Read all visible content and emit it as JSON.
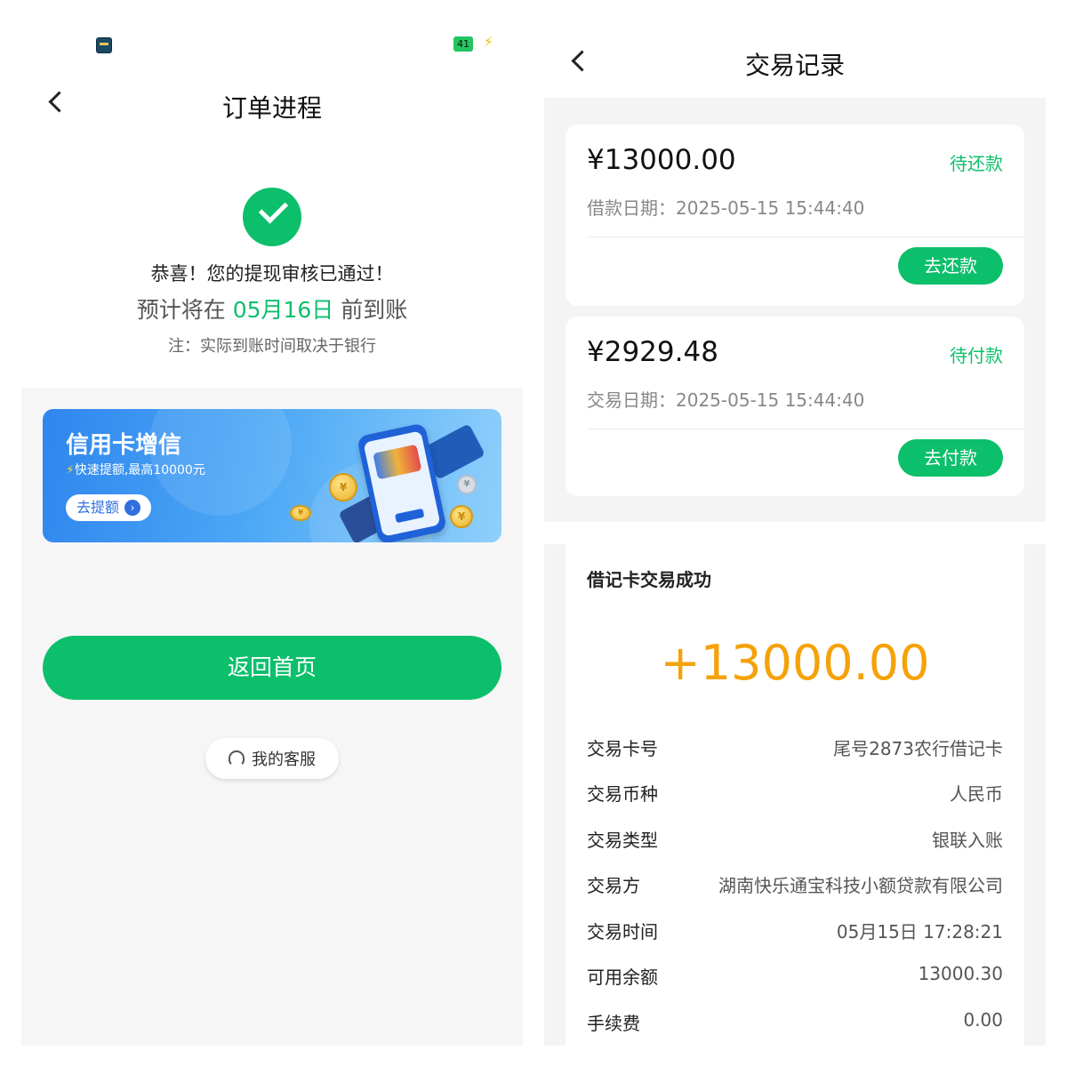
{
  "left": {
    "status": {
      "battery": "41"
    },
    "title": "订单进程",
    "message": "恭喜！您的提现审核已通过！",
    "eta_prefix": "预计将在",
    "eta_date": "05月16日",
    "eta_suffix": "前到账",
    "note": "注：实际到账时间取决于银行",
    "banner": {
      "title": "信用卡增信",
      "subtitle": "快速提额,最高10000元",
      "button": "去提额"
    },
    "home_button": "返回首页",
    "service_button": "我的客服"
  },
  "right": {
    "title": "交易记录",
    "records": [
      {
        "amount": "¥13000.00",
        "status": "待还款",
        "date": "借款日期：2025-05-15 15:44:40",
        "action": "去还款"
      },
      {
        "amount": "¥2929.48",
        "status": "待付款",
        "date": "交易日期：2025-05-15 15:44:40",
        "action": "去付款"
      }
    ],
    "detail": {
      "title": "借记卡交易成功",
      "amount": "+13000.00",
      "rows": [
        {
          "label": "交易卡号",
          "value": "尾号2873农行借记卡"
        },
        {
          "label": "交易币种",
          "value": "人民币"
        },
        {
          "label": "交易类型",
          "value": "银联入账"
        },
        {
          "label": "交易方",
          "value": "湖南快乐通宝科技小额贷款有限公司"
        },
        {
          "label": "交易时间",
          "value": "05月15日 17:28:21"
        },
        {
          "label": "可用余额",
          "value": "13000.30"
        },
        {
          "label": "手续费",
          "value": "0.00"
        }
      ]
    }
  },
  "colors": {
    "accent_green": "#0cbf6b",
    "amount_orange": "#f5a20a",
    "banner_blue": "#2f86ee"
  }
}
